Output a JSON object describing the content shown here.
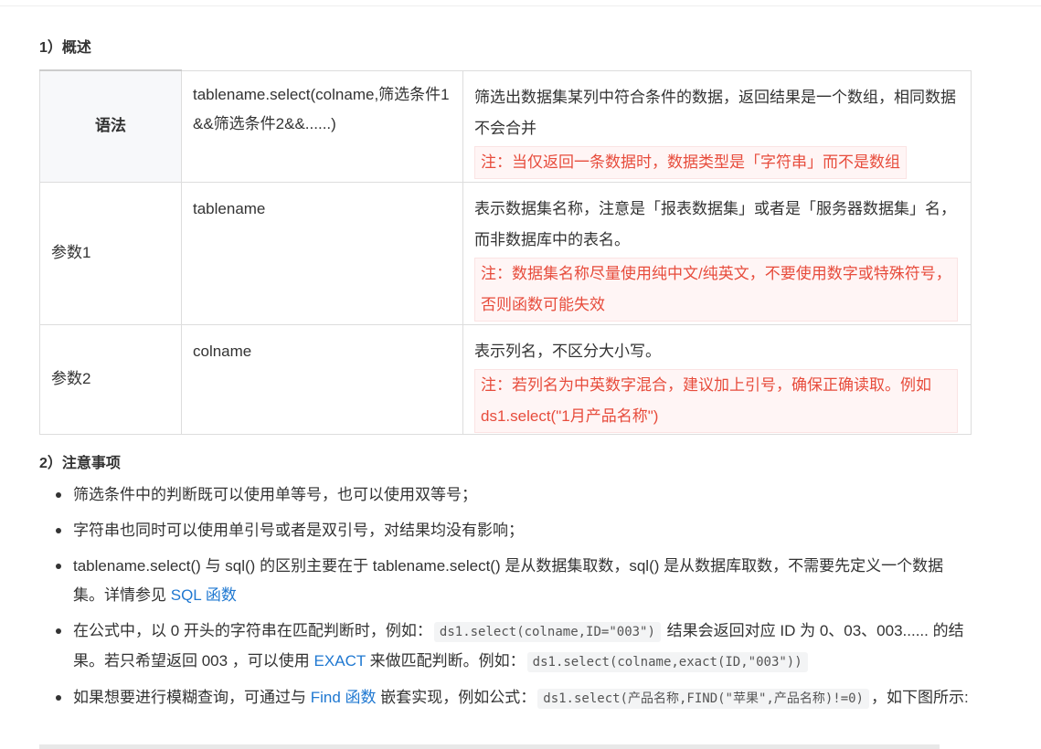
{
  "section1_title": "1）概述",
  "table": {
    "row1": {
      "label": "语法",
      "syntax": "tablename.select(colname,筛选条件1&&筛选条件2&&......)",
      "desc": "筛选出数据集某列中符合条件的数据，返回结果是一个数组，相同数据不会合并",
      "note": "注：当仅返回一条数据时，数据类型是「字符串」而不是数组"
    },
    "row2": {
      "label": "参数1",
      "param": "tablename",
      "desc": "表示数据集名称，注意是「报表数据集」或者是「服务器数据集」名，而非数据库中的表名。",
      "note": "注：数据集名称尽量使用纯中文/纯英文，不要使用数字或特殊符号，否则函数可能失效"
    },
    "row3": {
      "label": "参数2",
      "param": "colname",
      "desc": "表示列名，不区分大小写。",
      "note": "注：若列名为中英数字混合，建议加上引号，确保正确读取。例如 ds1.select(\"1月产品名称\")"
    }
  },
  "section2_title": "2）注意事项",
  "notes": {
    "item1": "筛选条件中的判断既可以使用单等号，也可以使用双等号；",
    "item2": "字符串也同时可以使用单引号或者是双引号，对结果均没有影响；",
    "item3": {
      "text_a": "tablename.select() 与 sql() 的区别主要在于 tablename.select() 是从数据集取数，sql() 是从数据库取数，不需要先定义一个数据集。详情参见 ",
      "link": "SQL 函数"
    },
    "item4": {
      "text_a": "在公式中，以 0 开头的字符串在匹配判断时，例如：",
      "code_a": "ds1.select(colname,ID=\"003\")",
      "text_b": " 结果会返回对应 ID 为 0、03、003...... 的结果。若只希望返回 003 ，可以使用 ",
      "link": "EXACT",
      "text_c": " 来做匹配判断。例如：",
      "code_b": "ds1.select(colname,exact(ID,\"003\"))"
    },
    "item5": {
      "text_a": "如果想要进行模糊查询，可通过与 ",
      "link": "Find 函数",
      "text_b": " 嵌套实现，例如公式：",
      "code": "ds1.select(产品名称,FIND(\"苹果\",产品名称)!=0)",
      "text_c": "，如下图所示:"
    }
  },
  "colors": {
    "link": "#1f78d1",
    "note_text": "#e74c3c",
    "note_bg": "#fff5f5"
  }
}
